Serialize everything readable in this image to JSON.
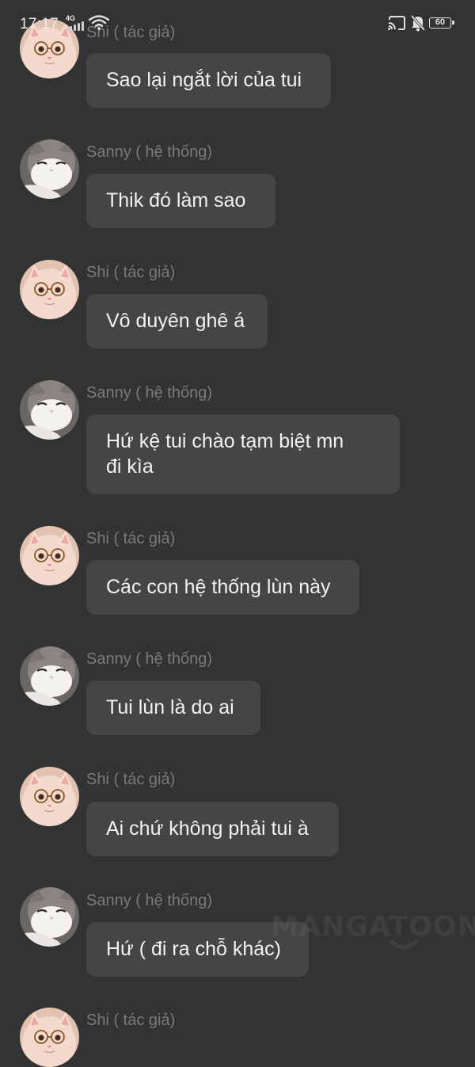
{
  "status_bar": {
    "time": "17:17",
    "network": "4G",
    "battery": "60"
  },
  "chat": {
    "messages": [
      {
        "sender": "Shi ( tác giả)",
        "text": "Sao lại ngắt lời của tui",
        "avatar": "cat-with-glasses"
      },
      {
        "sender": "Sanny ( hệ thống)",
        "text": "Thik đó làm sao",
        "avatar": "grey-white-cat"
      },
      {
        "sender": "Shi ( tác giả)",
        "text": "Vô duyên ghê á",
        "avatar": "cat-with-glasses"
      },
      {
        "sender": "Sanny ( hệ thống)",
        "text": "Hứ kệ tui chào tạm biệt mn\nđi kìa",
        "avatar": "grey-white-cat"
      },
      {
        "sender": "Shi ( tác giả)",
        "text": "Các con hệ thống lùn này",
        "avatar": "cat-with-glasses"
      },
      {
        "sender": "Sanny ( hệ thống)",
        "text": "Tui lùn là do ai",
        "avatar": "grey-white-cat"
      },
      {
        "sender": "Shi ( tác giả)",
        "text": "Ai chứ không phải tui à",
        "avatar": "cat-with-glasses"
      },
      {
        "sender": "Sanny ( hệ thống)",
        "text": "Hứ ( đi ra chỗ khác)",
        "avatar": "grey-white-cat"
      },
      {
        "sender": "Shi ( tác giả)",
        "text": "",
        "avatar": "cat-with-glasses"
      }
    ]
  },
  "watermark": "MANGATOON",
  "colors": {
    "background": "#333333",
    "bubble": "#454545",
    "sender_text": "#7a7a7a",
    "message_text": "#f2f2f2"
  }
}
